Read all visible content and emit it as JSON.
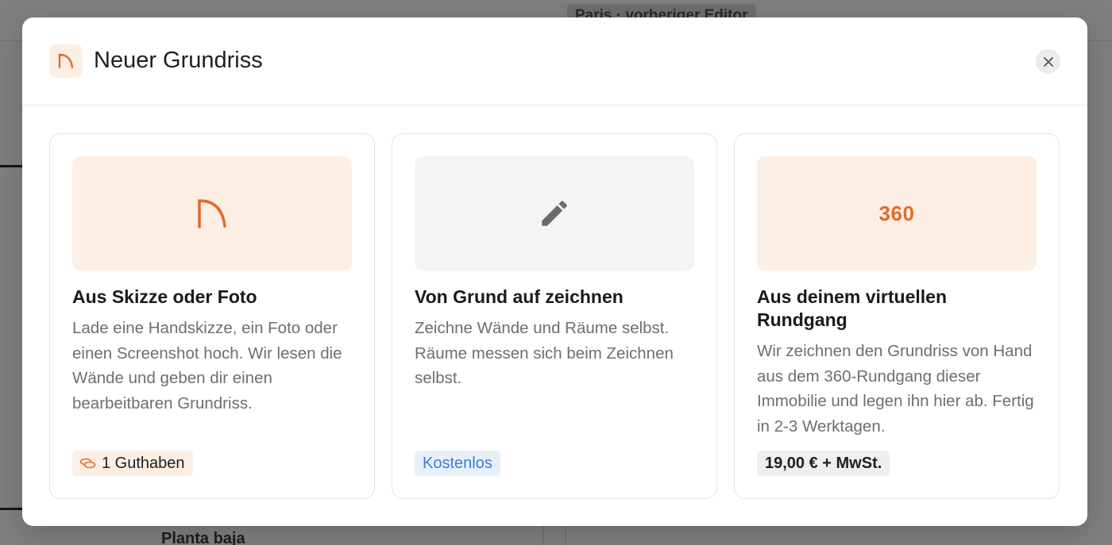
{
  "background": {
    "project_chip": "Paris · vorheriger Editor",
    "floor_label": "Planta baja"
  },
  "modal": {
    "title": "Neuer Grundriss",
    "header_icon": "floorplan-arc-icon",
    "close_icon": "close-icon"
  },
  "cards": [
    {
      "visual_icon": "floorplan-arc-icon",
      "title": "Aus Skizze oder Foto",
      "description": "Lade eine Handskizze, ein Foto oder einen Screenshot hoch. Wir lesen die Wände und geben dir einen bearbeitbaren Grundriss.",
      "badge": "1 Guthaben",
      "badge_icon": "coins-icon"
    },
    {
      "visual_icon": "pencil-icon",
      "title": "Von Grund auf zeichnen",
      "description": "Zeichne Wände und Räume selbst. Räume messen sich beim Zeichnen selbst.",
      "badge": "Kostenlos"
    },
    {
      "visual_text": "360",
      "title": "Aus deinem virtuellen Rundgang",
      "description": "Wir zeichnen den Grundriss von Hand aus dem 360-Rundgang dieser Immobilie und legen ihn hier ab. Fertig in 2-3 Werktagen.",
      "badge": "19,00 € + MwSt."
    }
  ],
  "colors": {
    "accent": "#e06b2d",
    "accent_bg": "#fdeee3",
    "free_badge_text": "#3b7fd0",
    "free_badge_bg": "#e7f0fa",
    "overlay": "#7f7f7f"
  }
}
